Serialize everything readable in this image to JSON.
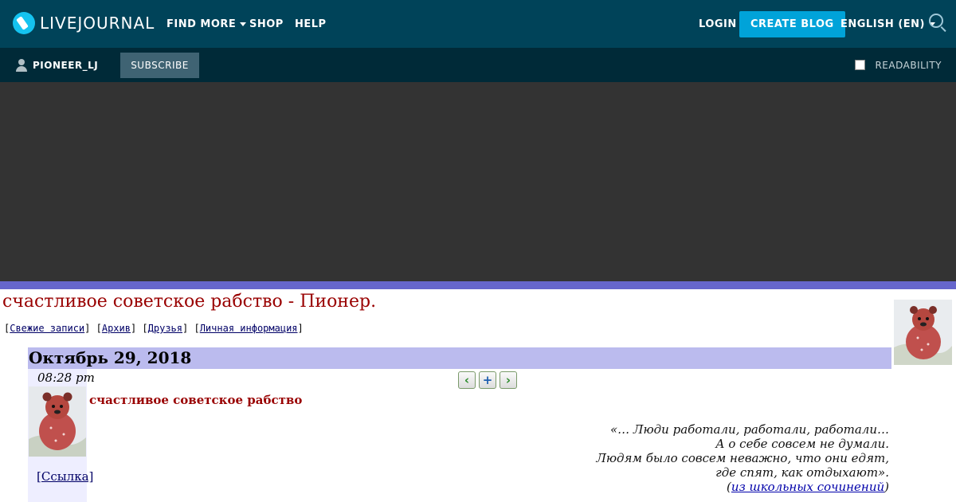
{
  "header": {
    "logo_text": "LIVEJOURNAL",
    "nav": {
      "find_more": "FIND MORE",
      "shop": "SHOP",
      "help": "HELP",
      "login": "LOGIN",
      "create_blog": "CREATE BLOG",
      "language": "ENGLISH (EN)"
    },
    "colors": {
      "bar": "#004359",
      "accent": "#00a3d9"
    }
  },
  "subbar": {
    "username": "PIONEER_LJ",
    "subscribe_label": "SUBSCRIBE",
    "readability_label": "READABILITY",
    "readability_checked": false
  },
  "journal": {
    "title": "счастливое советское рабство - Пионер.",
    "nav": {
      "recent": "Свежие записи",
      "archive": "Архив",
      "friends": "Друзья",
      "profile": "Личная информация"
    }
  },
  "entry": {
    "date": "Октябрь 29, 2018",
    "time": "08:28 pm",
    "subject": "счастливое советское рабство",
    "link_label": "[Ссылка]",
    "quote": {
      "lines": [
        "«… Люди работали, работали, работали…",
        "А о себе совсем не думали.",
        "Людям было совсем неважно, что они едят,",
        "где спят, как отдыхают»."
      ],
      "source_open": "(",
      "source_link": "из школьных сочинений",
      "source_close": ")"
    },
    "actions": {
      "prev": "previous-entry",
      "add": "add-to-memories",
      "next": "next-entry"
    }
  }
}
